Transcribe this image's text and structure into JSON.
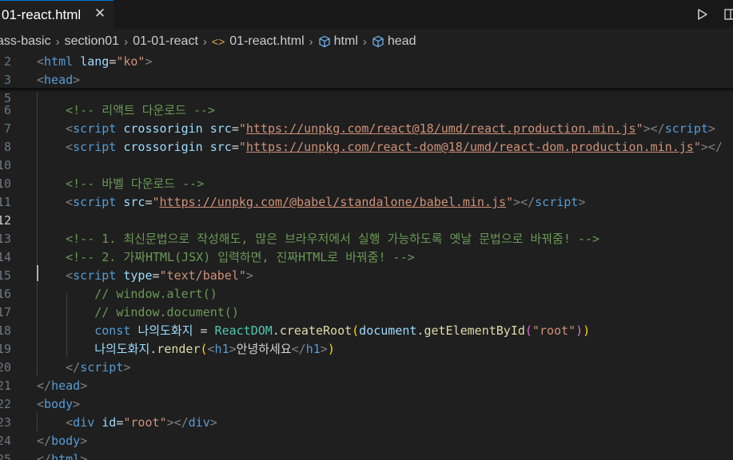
{
  "tab": {
    "title": "01-react.html",
    "close_glyph": "✕",
    "close_icon": "close-icon"
  },
  "toolbar": {
    "run_icon": "play-icon",
    "split_icon": "split-editor-icon"
  },
  "breadcrumb": {
    "items": [
      "ass-basic",
      "section01",
      "01-01-react",
      "01-react.html",
      "html",
      "head"
    ],
    "separator": "›",
    "file_icon": "<>"
  },
  "editor": {
    "active_line": "12",
    "lines": [
      {
        "n": "2",
        "tokens": [
          [
            "t-punct",
            "<"
          ],
          [
            "t-tag",
            "html"
          ],
          [
            "t-txt",
            " "
          ],
          [
            "t-attr",
            "lang"
          ],
          [
            "t-txt",
            "="
          ],
          [
            "t-str",
            "\"ko\""
          ],
          [
            "t-punct",
            ">"
          ]
        ]
      },
      {
        "n": "3",
        "tokens": [
          [
            "t-punct",
            "<"
          ],
          [
            "t-tag",
            "head"
          ],
          [
            "t-punct",
            ">"
          ]
        ]
      },
      {
        "n": "5",
        "tokens": []
      },
      {
        "n": "6",
        "tokens": [
          [
            "t-cmt",
            "    <!-- 리액트 다운로드 -->"
          ]
        ]
      },
      {
        "n": "7",
        "tokens": [
          [
            "t-txt",
            "    "
          ],
          [
            "t-punct",
            "<"
          ],
          [
            "t-tag",
            "script"
          ],
          [
            "t-txt",
            " "
          ],
          [
            "t-attr",
            "crossorigin"
          ],
          [
            "t-txt",
            " "
          ],
          [
            "t-attr",
            "src"
          ],
          [
            "t-txt",
            "="
          ],
          [
            "t-str",
            "\""
          ],
          [
            "t-url",
            "https://unpkg.com/react@18/umd/react.production.min.js"
          ],
          [
            "t-str",
            "\""
          ],
          [
            "t-punct",
            "></"
          ],
          [
            "t-tag",
            "script"
          ],
          [
            "t-punct",
            ">"
          ]
        ]
      },
      {
        "n": "8",
        "tokens": [
          [
            "t-txt",
            "    "
          ],
          [
            "t-punct",
            "<"
          ],
          [
            "t-tag",
            "script"
          ],
          [
            "t-txt",
            " "
          ],
          [
            "t-attr",
            "crossorigin"
          ],
          [
            "t-txt",
            " "
          ],
          [
            "t-attr",
            "src"
          ],
          [
            "t-txt",
            "="
          ],
          [
            "t-str",
            "\""
          ],
          [
            "t-url",
            "https://unpkg.com/react-dom@18/umd/react-dom.production.min.js"
          ],
          [
            "t-str",
            "\""
          ],
          [
            "t-punct",
            "></"
          ]
        ]
      },
      {
        "n": "10",
        "tokens": []
      },
      {
        "n": "10",
        "tokens": [
          [
            "t-cmt",
            "    <!-- 바벨 다운로드 -->"
          ]
        ]
      },
      {
        "n": "11",
        "tokens": [
          [
            "t-txt",
            "    "
          ],
          [
            "t-punct",
            "<"
          ],
          [
            "t-tag",
            "script"
          ],
          [
            "t-txt",
            " "
          ],
          [
            "t-attr",
            "src"
          ],
          [
            "t-txt",
            "="
          ],
          [
            "t-str",
            "\""
          ],
          [
            "t-url",
            "https://unpkg.com/@babel/standalone/babel.min.js"
          ],
          [
            "t-str",
            "\""
          ],
          [
            "t-punct",
            "></"
          ],
          [
            "t-tag",
            "script"
          ],
          [
            "t-punct",
            ">"
          ]
        ]
      },
      {
        "n": "12",
        "tokens": []
      },
      {
        "n": "13",
        "tokens": [
          [
            "t-cmt",
            "    <!-- 1. 최신문법으로 작성해도, 많은 브라우저에서 실행 가능하도록 옛날 문법으로 바꿔줌! -->"
          ]
        ]
      },
      {
        "n": "14",
        "tokens": [
          [
            "t-cmt",
            "    <!-- 2. 가짜HTML(JSX) 입력하면, 진짜HTML로 바꿔줌! -->"
          ]
        ]
      },
      {
        "n": "15",
        "tokens": [
          [
            "t-txt",
            "    "
          ],
          [
            "t-punct",
            "<"
          ],
          [
            "t-tag",
            "script"
          ],
          [
            "t-txt",
            " "
          ],
          [
            "t-attr",
            "type"
          ],
          [
            "t-txt",
            "="
          ],
          [
            "t-str",
            "\"text/babel\""
          ],
          [
            "t-punct",
            ">"
          ]
        ]
      },
      {
        "n": "16",
        "tokens": [
          [
            "t-cmt",
            "        // window.alert()"
          ]
        ]
      },
      {
        "n": "17",
        "tokens": [
          [
            "t-cmt",
            "        // window.document()"
          ]
        ]
      },
      {
        "n": "18",
        "tokens": [
          [
            "t-txt",
            "        "
          ],
          [
            "t-kw",
            "const"
          ],
          [
            "t-txt",
            " "
          ],
          [
            "t-var",
            "나의도화지"
          ],
          [
            "t-txt",
            " = "
          ],
          [
            "t-cls",
            "ReactDOM"
          ],
          [
            "t-txt",
            "."
          ],
          [
            "t-fn",
            "createRoot"
          ],
          [
            "t-paren",
            "("
          ],
          [
            "t-var",
            "document"
          ],
          [
            "t-txt",
            "."
          ],
          [
            "t-fn",
            "getElementById"
          ],
          [
            "t-paren2",
            "("
          ],
          [
            "t-str",
            "\"root\""
          ],
          [
            "t-paren2",
            ")"
          ],
          [
            "t-paren",
            ")"
          ]
        ]
      },
      {
        "n": "19",
        "tokens": [
          [
            "t-txt",
            "        "
          ],
          [
            "t-var",
            "나의도화지"
          ],
          [
            "t-txt",
            "."
          ],
          [
            "t-fn",
            "render"
          ],
          [
            "t-paren",
            "("
          ],
          [
            "t-punct",
            "<"
          ],
          [
            "t-tag",
            "h1"
          ],
          [
            "t-punct",
            ">"
          ],
          [
            "t-txt",
            "안녕하세요"
          ],
          [
            "t-punct",
            "</"
          ],
          [
            "t-tag",
            "h1"
          ],
          [
            "t-punct",
            ">"
          ],
          [
            "t-paren",
            ")"
          ]
        ]
      },
      {
        "n": "20",
        "tokens": [
          [
            "t-txt",
            "    "
          ],
          [
            "t-punct",
            "</"
          ],
          [
            "t-tag",
            "script"
          ],
          [
            "t-punct",
            ">"
          ]
        ]
      },
      {
        "n": "21",
        "tokens": [
          [
            "t-punct",
            "</"
          ],
          [
            "t-tag",
            "head"
          ],
          [
            "t-punct",
            ">"
          ]
        ]
      },
      {
        "n": "22",
        "tokens": [
          [
            "t-punct",
            "<"
          ],
          [
            "t-tag",
            "body"
          ],
          [
            "t-punct",
            ">"
          ]
        ]
      },
      {
        "n": "23",
        "tokens": [
          [
            "t-txt",
            "    "
          ],
          [
            "t-punct",
            "<"
          ],
          [
            "t-tag",
            "div"
          ],
          [
            "t-txt",
            " "
          ],
          [
            "t-attr",
            "id"
          ],
          [
            "t-txt",
            "="
          ],
          [
            "t-str",
            "\"root\""
          ],
          [
            "t-punct",
            "></"
          ],
          [
            "t-tag",
            "div"
          ],
          [
            "t-punct",
            ">"
          ]
        ]
      },
      {
        "n": "24",
        "tokens": [
          [
            "t-punct",
            "</"
          ],
          [
            "t-tag",
            "body"
          ],
          [
            "t-punct",
            ">"
          ]
        ]
      },
      {
        "n": "25",
        "tokens": [
          [
            "t-punct",
            "</"
          ],
          [
            "t-tag",
            "html"
          ],
          [
            "t-punct",
            ">"
          ]
        ]
      }
    ]
  }
}
